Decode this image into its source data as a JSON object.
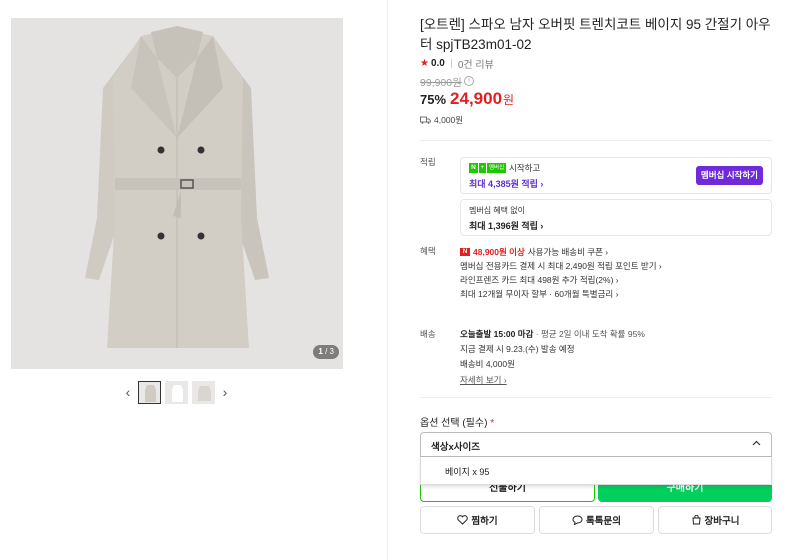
{
  "gallery": {
    "counter_current": "1",
    "counter_total": " / 3",
    "prev": "‹",
    "next": "›"
  },
  "product": {
    "title": "[오트렌] 스파오 남자 오버핏 트렌치코트 베이지 95 간절기 아우터 spjTB23m01-02",
    "rating": "0.0",
    "review_count": "0건 리뷰",
    "original_price": "99,900원",
    "discount_rate": "75%",
    "sale_price": "24,900",
    "currency": "원",
    "shipping_fee": "4,000원"
  },
  "points": {
    "label": "적립",
    "start_text": "시작하고",
    "max_with_membership": "최대 4,385원 적립 ›",
    "membership_button": "멤버십 시작하기",
    "no_membership_text": "멤버십 혜택 없이",
    "max_without_membership": "최대 1,396원 적립 ›",
    "badge_n": "N",
    "badge_plus": "+",
    "badge_membership": "멤버십"
  },
  "benefits": {
    "label": "혜택",
    "coupon_amount": "48,900원 이상",
    "coupon_text": "사용가능 배송비 쿠폰 ›",
    "line2": "멤버십 전용카드 결제 시 최대 2,490원 적립 포인트 받기 ›",
    "line3": "라인프렌즈 카드 최대 498원 추가 적립(2%) ›",
    "line4": "최대 12개월 무이자 할부 · 60개월 특별금리 ›"
  },
  "delivery": {
    "label": "배송",
    "today_bold": "오늘출발 15:00 마감",
    "today_rest": " · 평균 2일 이내 도착 확률 95%",
    "line2": "지금 결제 시 9.23.(수) 발송 예정",
    "line3": "배송비 4,000원",
    "detail_link": "자세히 보기 ›"
  },
  "options": {
    "label": "옵션 선택 (필수)",
    "required_mark": "*",
    "dropdown_value": "색상x사이즈",
    "items": [
      "베이지 x 95"
    ]
  },
  "actions": {
    "gift": "선물하기",
    "buy": "구매하기",
    "wish": "찜하기",
    "talk": "톡톡문의",
    "cart": "장바구니"
  },
  "colors": {
    "accent_red": "#e12020",
    "naver_green": "#03cf5d",
    "membership_purple": "#6f2bd9"
  }
}
